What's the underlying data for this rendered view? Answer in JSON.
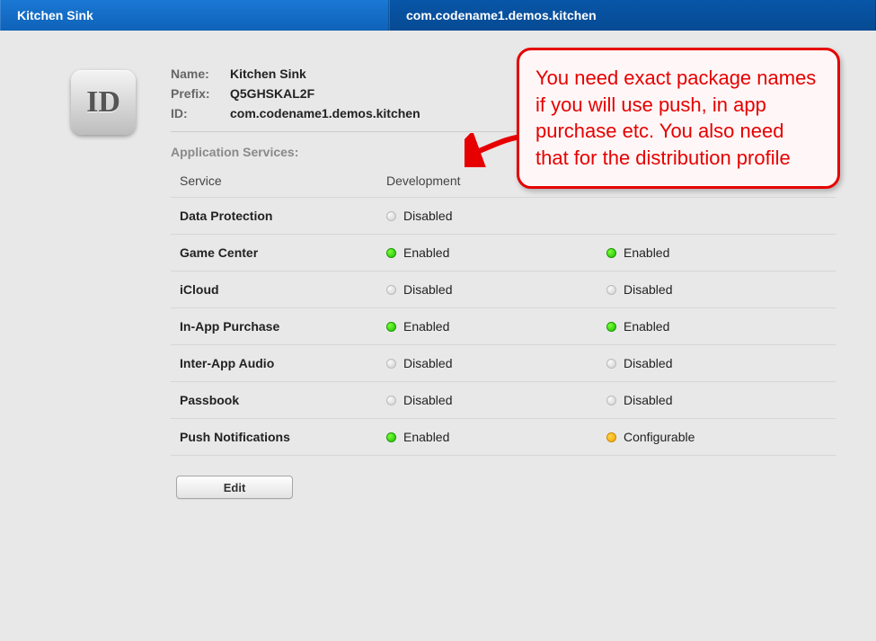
{
  "tabs": {
    "left": "Kitchen Sink",
    "right": "com.codename1.demos.kitchen"
  },
  "icon_text": "ID",
  "info": {
    "name_label": "Name:",
    "name_value": "Kitchen Sink",
    "prefix_label": "Prefix:",
    "prefix_value": "Q5GHSKAL2F",
    "id_label": "ID:",
    "id_value": "com.codename1.demos.kitchen"
  },
  "section_heading": "Application Services:",
  "columns": {
    "service": "Service",
    "dev": "Development",
    "dist": ""
  },
  "services": [
    {
      "name": "Data Protection",
      "dev_state": "disabled",
      "dev_text": "Disabled",
      "dist_state": "",
      "dist_text": ""
    },
    {
      "name": "Game Center",
      "dev_state": "enabled",
      "dev_text": "Enabled",
      "dist_state": "enabled",
      "dist_text": "Enabled"
    },
    {
      "name": "iCloud",
      "dev_state": "disabled",
      "dev_text": "Disabled",
      "dist_state": "disabled",
      "dist_text": "Disabled"
    },
    {
      "name": "In-App Purchase",
      "dev_state": "enabled",
      "dev_text": "Enabled",
      "dist_state": "enabled",
      "dist_text": "Enabled"
    },
    {
      "name": "Inter-App Audio",
      "dev_state": "disabled",
      "dev_text": "Disabled",
      "dist_state": "disabled",
      "dist_text": "Disabled"
    },
    {
      "name": "Passbook",
      "dev_state": "disabled",
      "dev_text": "Disabled",
      "dist_state": "disabled",
      "dist_text": "Disabled"
    },
    {
      "name": "Push Notifications",
      "dev_state": "enabled",
      "dev_text": "Enabled",
      "dist_state": "config",
      "dist_text": "Configurable"
    }
  ],
  "edit_button": "Edit",
  "callout_text": "You need exact package names if you will use push, in app purchase etc. You also need that for the distribution profile"
}
